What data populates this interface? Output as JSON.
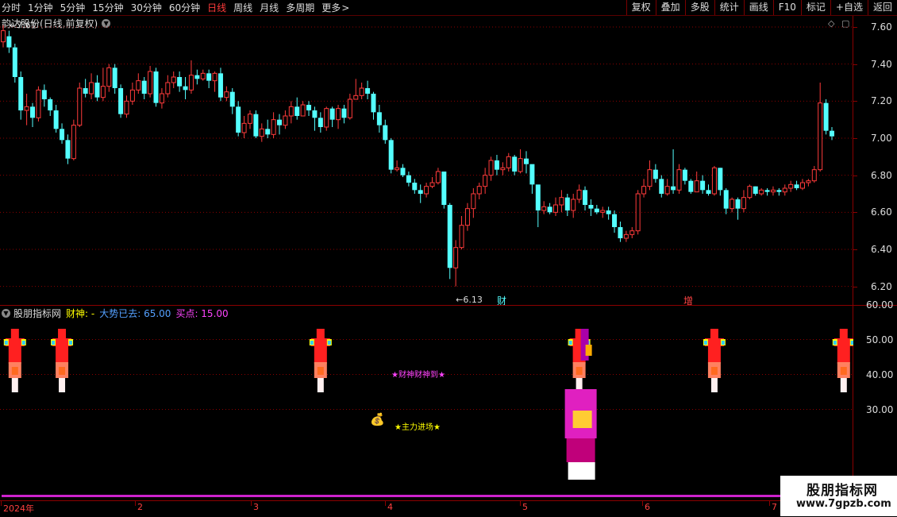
{
  "toolbar": {
    "periods": [
      "分时",
      "1分钟",
      "5分钟",
      "15分钟",
      "30分钟",
      "60分钟",
      "日线",
      "周线",
      "月线",
      "多周期",
      "更多"
    ],
    "active_period": "日线",
    "more_arrow": ">",
    "actions": [
      "复权",
      "叠加",
      "多股",
      "统计",
      "画线",
      "F10",
      "标记",
      "+自选",
      "返回"
    ]
  },
  "stock_title": "韵达股份(日线,前复权)",
  "price_axis": [
    "7.60",
    "7.40",
    "7.20",
    "7.00",
    "6.80",
    "6.60",
    "6.40",
    "6.20"
  ],
  "high_marker": "7.61",
  "low_marker": "6.13",
  "event_markers": {
    "cai": "财",
    "zeng": "增"
  },
  "indicator": {
    "name": "股朋指标网",
    "caishen_label": "财神: -",
    "trend_label": "大势已去: 65.00",
    "buy_label": "买点: 15.00",
    "axis": [
      "60.00",
      "50.00",
      "40.00",
      "30.00"
    ],
    "signal_text_1": "★财神财神到★",
    "signal_text_2": "★主力进场★",
    "money_icon": "💰"
  },
  "dates": [
    "2024年",
    "2",
    "3",
    "4",
    "5",
    "6",
    "7"
  ],
  "watermark": {
    "title": "股朋指标网",
    "url": "www.7gpzb.com"
  },
  "colors": {
    "up": "#ff3b3b",
    "down": "#54ffff",
    "grid": "#8b0000"
  },
  "chart_data": {
    "type": "candlestick",
    "ylim": [
      6.1,
      7.66
    ],
    "candles": [
      [
        7.52,
        7.58,
        7.61,
        7.49
      ],
      [
        7.55,
        7.49,
        7.58,
        7.46
      ],
      [
        7.49,
        7.33,
        7.51,
        7.3
      ],
      [
        7.33,
        7.15,
        7.36,
        7.1
      ],
      [
        7.15,
        7.17,
        7.24,
        7.07
      ],
      [
        7.17,
        7.11,
        7.19,
        7.06
      ],
      [
        7.11,
        7.26,
        7.28,
        7.09
      ],
      [
        7.26,
        7.21,
        7.29,
        7.17
      ],
      [
        7.21,
        7.15,
        7.22,
        7.12
      ],
      [
        7.15,
        7.05,
        7.18,
        7.03
      ],
      [
        7.05,
        6.99,
        7.08,
        6.97
      ],
      [
        6.99,
        6.89,
        7.02,
        6.86
      ],
      [
        6.89,
        7.07,
        7.1,
        6.88
      ],
      [
        7.07,
        7.27,
        7.3,
        7.06
      ],
      [
        7.27,
        7.24,
        7.32,
        7.22
      ],
      [
        7.24,
        7.3,
        7.35,
        7.21
      ],
      [
        7.3,
        7.22,
        7.34,
        7.2
      ],
      [
        7.22,
        7.28,
        7.38,
        7.2
      ],
      [
        7.28,
        7.38,
        7.4,
        7.25
      ],
      [
        7.38,
        7.27,
        7.4,
        7.24
      ],
      [
        7.27,
        7.13,
        7.29,
        7.11
      ],
      [
        7.13,
        7.2,
        7.23,
        7.11
      ],
      [
        7.2,
        7.26,
        7.3,
        7.18
      ],
      [
        7.26,
        7.31,
        7.35,
        7.24
      ],
      [
        7.31,
        7.24,
        7.33,
        7.21
      ],
      [
        7.24,
        7.36,
        7.39,
        7.22
      ],
      [
        7.36,
        7.19,
        7.38,
        7.17
      ],
      [
        7.19,
        7.24,
        7.27,
        7.16
      ],
      [
        7.24,
        7.3,
        7.34,
        7.22
      ],
      [
        7.3,
        7.33,
        7.36,
        7.27
      ],
      [
        7.33,
        7.28,
        7.36,
        7.25
      ],
      [
        7.28,
        7.26,
        7.33,
        7.21
      ],
      [
        7.26,
        7.34,
        7.42,
        7.24
      ],
      [
        7.34,
        7.32,
        7.37,
        7.29
      ],
      [
        7.32,
        7.35,
        7.37,
        7.31
      ],
      [
        7.35,
        7.31,
        7.37,
        7.27
      ],
      [
        7.31,
        7.35,
        7.36,
        7.25
      ],
      [
        7.35,
        7.22,
        7.38,
        7.2
      ],
      [
        7.22,
        7.25,
        7.28,
        7.2
      ],
      [
        7.25,
        7.17,
        7.27,
        7.13
      ],
      [
        7.17,
        7.03,
        7.2,
        7.01
      ],
      [
        7.03,
        7.08,
        7.12,
        7.0
      ],
      [
        7.08,
        7.13,
        7.15,
        7.05
      ],
      [
        7.13,
        7.01,
        7.15,
        7.0
      ],
      [
        7.01,
        7.05,
        7.08,
        6.98
      ],
      [
        7.05,
        7.02,
        7.1,
        7.0
      ],
      [
        7.02,
        7.1,
        7.14,
        7.0
      ],
      [
        7.1,
        7.07,
        7.13,
        7.02
      ],
      [
        7.07,
        7.12,
        7.15,
        7.05
      ],
      [
        7.12,
        7.17,
        7.2,
        7.08
      ],
      [
        7.17,
        7.12,
        7.22,
        7.1
      ],
      [
        7.12,
        7.18,
        7.2,
        7.12
      ],
      [
        7.18,
        7.15,
        7.2,
        7.12
      ],
      [
        7.15,
        7.11,
        7.17,
        7.04
      ],
      [
        7.11,
        7.06,
        7.14,
        7.03
      ],
      [
        7.06,
        7.16,
        7.17,
        7.04
      ],
      [
        7.16,
        7.1,
        7.17,
        7.06
      ],
      [
        7.1,
        7.16,
        7.18,
        7.05
      ],
      [
        7.16,
        7.11,
        7.18,
        7.08
      ],
      [
        7.11,
        7.21,
        7.24,
        7.1
      ],
      [
        7.21,
        7.23,
        7.32,
        7.21
      ],
      [
        7.23,
        7.27,
        7.3,
        7.21
      ],
      [
        7.27,
        7.24,
        7.31,
        7.21
      ],
      [
        7.24,
        7.14,
        7.25,
        7.1
      ],
      [
        7.14,
        7.07,
        7.18,
        7.03
      ],
      [
        7.07,
        6.99,
        7.1,
        6.97
      ],
      [
        6.99,
        6.83,
        7.0,
        6.81
      ],
      [
        6.83,
        6.84,
        6.88,
        6.82
      ],
      [
        6.84,
        6.8,
        6.86,
        6.79
      ],
      [
        6.8,
        6.76,
        6.82,
        6.74
      ],
      [
        6.76,
        6.72,
        6.78,
        6.7
      ],
      [
        6.72,
        6.7,
        6.75,
        6.65
      ],
      [
        6.7,
        6.74,
        6.76,
        6.68
      ],
      [
        6.74,
        6.76,
        6.79,
        6.73
      ],
      [
        6.76,
        6.82,
        6.84,
        6.75
      ],
      [
        6.82,
        6.64,
        6.68,
        6.62
      ],
      [
        6.64,
        6.3,
        6.65,
        6.24
      ],
      [
        6.3,
        6.41,
        6.45,
        6.2
      ],
      [
        6.41,
        6.53,
        6.58,
        6.4
      ],
      [
        6.53,
        6.62,
        6.65,
        6.5
      ],
      [
        6.62,
        6.7,
        6.73,
        6.57
      ],
      [
        6.7,
        6.74,
        6.76,
        6.67
      ],
      [
        6.74,
        6.8,
        6.84,
        6.7
      ],
      [
        6.8,
        6.88,
        6.9,
        6.77
      ],
      [
        6.88,
        6.83,
        6.91,
        6.8
      ],
      [
        6.83,
        6.84,
        6.87,
        6.8
      ],
      [
        6.84,
        6.9,
        6.92,
        6.82
      ],
      [
        6.9,
        6.82,
        6.91,
        6.8
      ],
      [
        6.82,
        6.89,
        6.94,
        6.81
      ],
      [
        6.89,
        6.86,
        6.93,
        6.81
      ],
      [
        6.86,
        6.75,
        6.85,
        6.7
      ],
      [
        6.75,
        6.61,
        6.67,
        6.52
      ],
      [
        6.61,
        6.63,
        6.66,
        6.59
      ],
      [
        6.63,
        6.6,
        6.65,
        6.59
      ],
      [
        6.6,
        6.64,
        6.68,
        6.58
      ],
      [
        6.64,
        6.68,
        6.72,
        6.6
      ],
      [
        6.68,
        6.61,
        6.7,
        6.58
      ],
      [
        6.61,
        6.67,
        6.7,
        6.57
      ],
      [
        6.67,
        6.72,
        6.75,
        6.65
      ],
      [
        6.72,
        6.64,
        6.74,
        6.61
      ],
      [
        6.64,
        6.62,
        6.67,
        6.58
      ],
      [
        6.62,
        6.6,
        6.64,
        6.59
      ],
      [
        6.6,
        6.61,
        6.63,
        6.57
      ],
      [
        6.61,
        6.59,
        6.63,
        6.56
      ],
      [
        6.59,
        6.52,
        6.61,
        6.49
      ],
      [
        6.52,
        6.46,
        6.55,
        6.44
      ],
      [
        6.46,
        6.48,
        6.5,
        6.44
      ],
      [
        6.48,
        6.5,
        6.52,
        6.46
      ],
      [
        6.5,
        6.7,
        6.72,
        6.48
      ],
      [
        6.7,
        6.74,
        6.78,
        6.68
      ],
      [
        6.74,
        6.83,
        6.88,
        6.72
      ],
      [
        6.83,
        6.78,
        6.86,
        6.76
      ],
      [
        6.78,
        6.7,
        6.8,
        6.68
      ],
      [
        6.7,
        6.74,
        6.78,
        6.69
      ],
      [
        6.74,
        6.72,
        6.94,
        6.7
      ],
      [
        6.72,
        6.83,
        6.86,
        6.7
      ],
      [
        6.83,
        6.77,
        6.84,
        6.75
      ],
      [
        6.77,
        6.71,
        6.78,
        6.7
      ],
      [
        6.71,
        6.77,
        6.82,
        6.72
      ],
      [
        6.77,
        6.72,
        6.8,
        6.7
      ],
      [
        6.72,
        6.7,
        6.75,
        6.69
      ],
      [
        6.7,
        6.84,
        6.85,
        6.69
      ],
      [
        6.84,
        6.72,
        6.84,
        6.69
      ],
      [
        6.72,
        6.62,
        6.73,
        6.59
      ],
      [
        6.62,
        6.67,
        6.68,
        6.6
      ],
      [
        6.67,
        6.62,
        6.68,
        6.56
      ],
      [
        6.62,
        6.68,
        6.72,
        6.6
      ],
      [
        6.68,
        6.74,
        6.75,
        6.67
      ],
      [
        6.74,
        6.7,
        6.74,
        6.69
      ],
      [
        6.7,
        6.72,
        6.73,
        6.69
      ],
      [
        6.72,
        6.71,
        6.73,
        6.69
      ],
      [
        6.71,
        6.72,
        6.74,
        6.69
      ],
      [
        6.72,
        6.71,
        6.73,
        6.69
      ],
      [
        6.71,
        6.73,
        6.75,
        6.69
      ],
      [
        6.73,
        6.75,
        6.77,
        6.71
      ],
      [
        6.75,
        6.73,
        6.77,
        6.72
      ],
      [
        6.73,
        6.76,
        6.78,
        6.72
      ],
      [
        6.76,
        6.77,
        6.78,
        6.74
      ],
      [
        6.77,
        6.83,
        6.85,
        6.76
      ],
      [
        6.83,
        7.19,
        7.3,
        6.82
      ],
      [
        7.19,
        7.04,
        7.21,
        7.02
      ],
      [
        7.04,
        7.01,
        7.06,
        6.99
      ]
    ],
    "indicator_signals": [
      2,
      10,
      54,
      98,
      121,
      143
    ],
    "buy_signal": 98
  }
}
